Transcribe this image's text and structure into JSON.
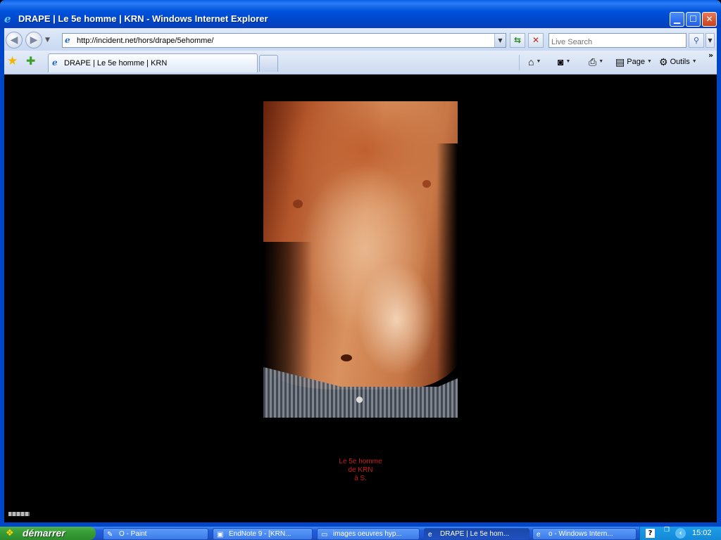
{
  "window": {
    "title": "DRAPE | Le 5e homme | KRN - Windows Internet Explorer",
    "min_glyph": "▁",
    "max_glyph": "☐",
    "close_glyph": "✕"
  },
  "addressbar": {
    "back_glyph": "◀",
    "forward_glyph": "▶",
    "url": "http://incident.net/hors/drape/5ehomme/",
    "search_placeholder": "Live Search"
  },
  "tabs": [
    {
      "label": "DRAPE | Le 5e homme | KRN"
    }
  ],
  "commandbar": {
    "page_label": "Page",
    "tools_label": "Outils"
  },
  "content": {
    "caption_lines": [
      "Le 5e homme",
      "de KRN",
      "à S."
    ]
  },
  "taskbar": {
    "start_label": "démarrer",
    "tasks": [
      {
        "label": "O - Paint",
        "icon": "paint-icon"
      },
      {
        "label": "EndNote 9 - [KRN...",
        "icon": "endnote-icon"
      },
      {
        "label": "images oeuvres hyp...",
        "icon": "folder-icon"
      },
      {
        "label": "DRAPE | Le 5e hom...",
        "icon": "ie-icon",
        "active": true
      },
      {
        "label": "o - Windows Intern...",
        "icon": "ie-icon"
      }
    ],
    "clock": "15:02"
  }
}
